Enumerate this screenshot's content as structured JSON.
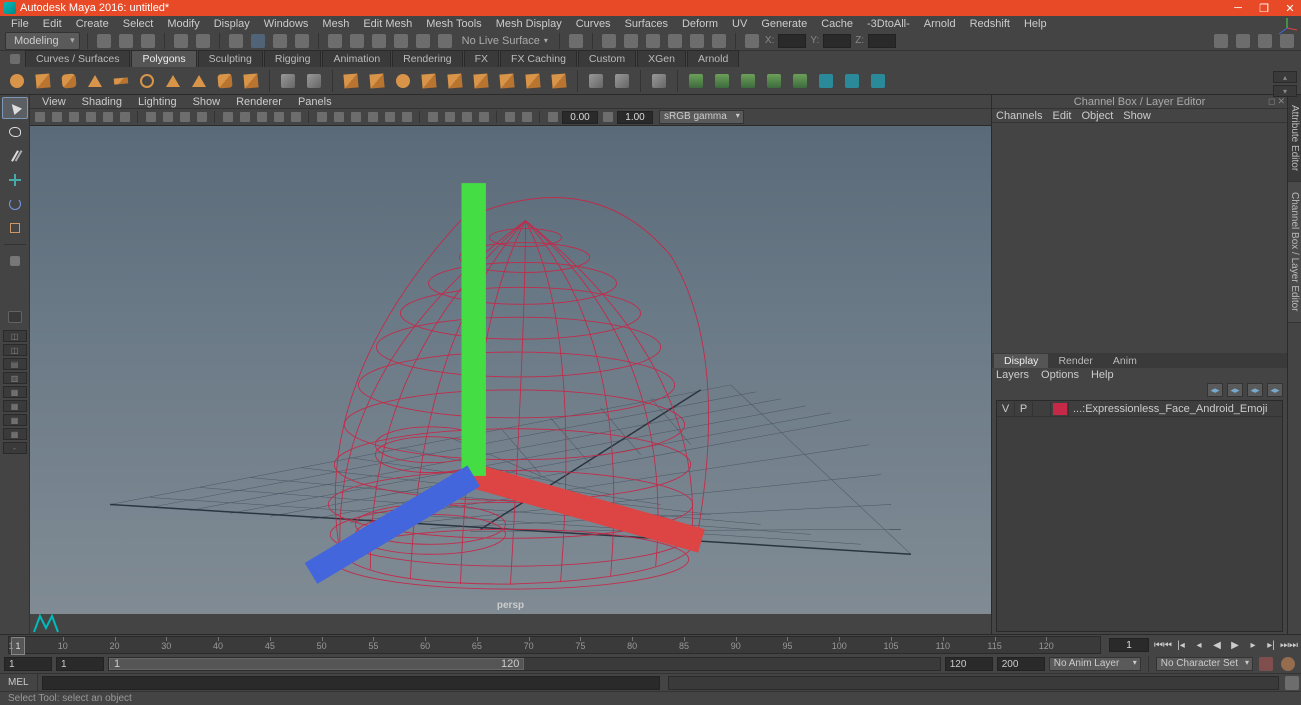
{
  "title": "Autodesk Maya 2016: untitled*",
  "menubar": [
    "File",
    "Edit",
    "Create",
    "Select",
    "Modify",
    "Display",
    "Windows",
    "Mesh",
    "Edit Mesh",
    "Mesh Tools",
    "Mesh Display",
    "Curves",
    "Surfaces",
    "Deform",
    "UV",
    "Generate",
    "Cache",
    "-3DtoAll-",
    "Arnold",
    "Redshift",
    "Help"
  ],
  "mode": "Modeling",
  "status": {
    "live_surface": "No Live Surface",
    "axis_x": "X:",
    "axis_y": "Y:",
    "axis_z": "Z:"
  },
  "shelf_tabs": [
    "Curves / Surfaces",
    "Polygons",
    "Sculpting",
    "Rigging",
    "Animation",
    "Rendering",
    "FX",
    "FX Caching",
    "Custom",
    "XGen",
    "Arnold"
  ],
  "shelf_active": "Polygons",
  "panel_menu": [
    "View",
    "Shading",
    "Lighting",
    "Show",
    "Renderer",
    "Panels"
  ],
  "panel_toolbar": {
    "exposure": "0.00",
    "gamma": "1.00",
    "colorspace": "sRGB gamma"
  },
  "camera": "persp",
  "channel_box": {
    "title": "Channel Box / Layer Editor",
    "menu": [
      "Channels",
      "Edit",
      "Object",
      "Show"
    ],
    "tabs": [
      "Display",
      "Render",
      "Anim"
    ],
    "active_tab": "Display",
    "submenu": [
      "Layers",
      "Options",
      "Help"
    ],
    "layers": [
      {
        "vis": "V",
        "play": "P",
        "color": "#c62848",
        "name": "...:Expressionless_Face_Android_Emoji"
      }
    ]
  },
  "right_vtabs": [
    "Attribute Editor",
    "Channel Box / Layer Editor"
  ],
  "timeline": {
    "ticks": [
      "1",
      "10",
      "20",
      "30",
      "40",
      "45",
      "50",
      "55",
      "60",
      "65",
      "70",
      "75",
      "80",
      "85",
      "90",
      "95",
      "100",
      "105",
      "110",
      "115",
      "120"
    ],
    "current": "1",
    "range_start_outer": "1",
    "range_start_inner": "1",
    "range_end_inner": "120",
    "range_thumb_start": "1",
    "range_thumb_end": "120",
    "range_end_outer_a": "120",
    "range_end_outer_b": "200",
    "anim_layer": "No Anim Layer",
    "char_set": "No Character Set"
  },
  "cmd": {
    "lang": "MEL"
  },
  "help_line": "Select Tool: select an object"
}
